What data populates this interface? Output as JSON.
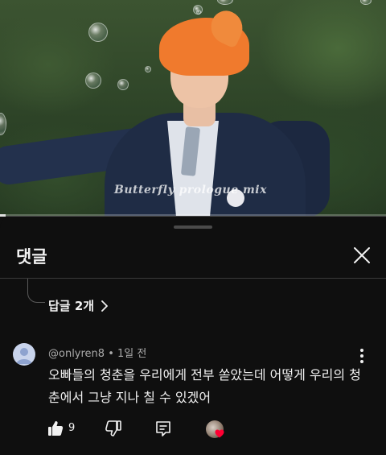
{
  "video": {
    "watermark": "Butterfly prologue mix",
    "progress_percent": 1.5
  },
  "panel": {
    "title": "댓글",
    "close_icon": "close-icon"
  },
  "replies": {
    "label": "답글 2개",
    "chevron_icon": "chevron-right-icon"
  },
  "comment": {
    "author": "@onlyren8",
    "separator": " • ",
    "time": "1일 전",
    "text": "오빠들의 청춘을 우리에게 전부 쏟았는데 어떻게 우리의 청춘에서 그냥 지나 칠 수 있겠어",
    "likes": "9",
    "icons": {
      "like": "thumbs-up-icon",
      "dislike": "thumbs-down-icon",
      "reply": "reply-icon",
      "more": "more-vert-icon",
      "creator_heart": "creator-heart-icon"
    }
  },
  "colors": {
    "background": "#0f0f0f",
    "text_primary": "#f1f1f1",
    "text_secondary": "#aaaaaa",
    "heart": "#ff0033"
  }
}
